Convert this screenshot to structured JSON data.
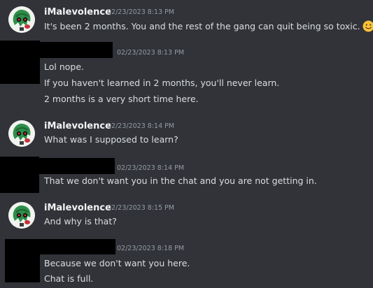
{
  "messages": [
    {
      "author": "iMalevolence",
      "timestamp": "02/23/2023 8:13 PM",
      "avatar_icon": "green-haired-character-avatar",
      "lines": [
        "It's been 2 months. You and the rest of the gang can quit being so toxic."
      ],
      "emoji": "slightly-smiling-face-icon"
    },
    {
      "author": "",
      "author_redacted": true,
      "timestamp": "02/23/2023 8:13 PM",
      "lines": [
        "Lol nope.",
        "If you haven't learned in 2 months, you'll never learn.",
        "2 months is a very short time here."
      ]
    },
    {
      "author": "iMalevolence",
      "timestamp": "02/23/2023 8:14 PM",
      "avatar_icon": "green-haired-character-avatar",
      "lines": [
        "What was I supposed to learn?"
      ]
    },
    {
      "author": "",
      "author_redacted": true,
      "timestamp": "02/23/2023 8:14 PM",
      "lines": [
        "That we don't want you in the chat and you are not getting in."
      ]
    },
    {
      "author": "iMalevolence",
      "timestamp": "02/23/2023 8:15 PM",
      "avatar_icon": "green-haired-character-avatar",
      "lines": [
        "And why is that?"
      ]
    },
    {
      "author": "",
      "author_redacted": true,
      "timestamp": "02/23/2023 8:18 PM",
      "lines": [
        "Because we don't want you here.",
        "Chat is full."
      ]
    }
  ],
  "colors": {
    "background": "#313338",
    "username": "#f2f3f5",
    "timestamp": "#949ba4",
    "message_text": "#dbdee1",
    "redaction": "#000000"
  }
}
